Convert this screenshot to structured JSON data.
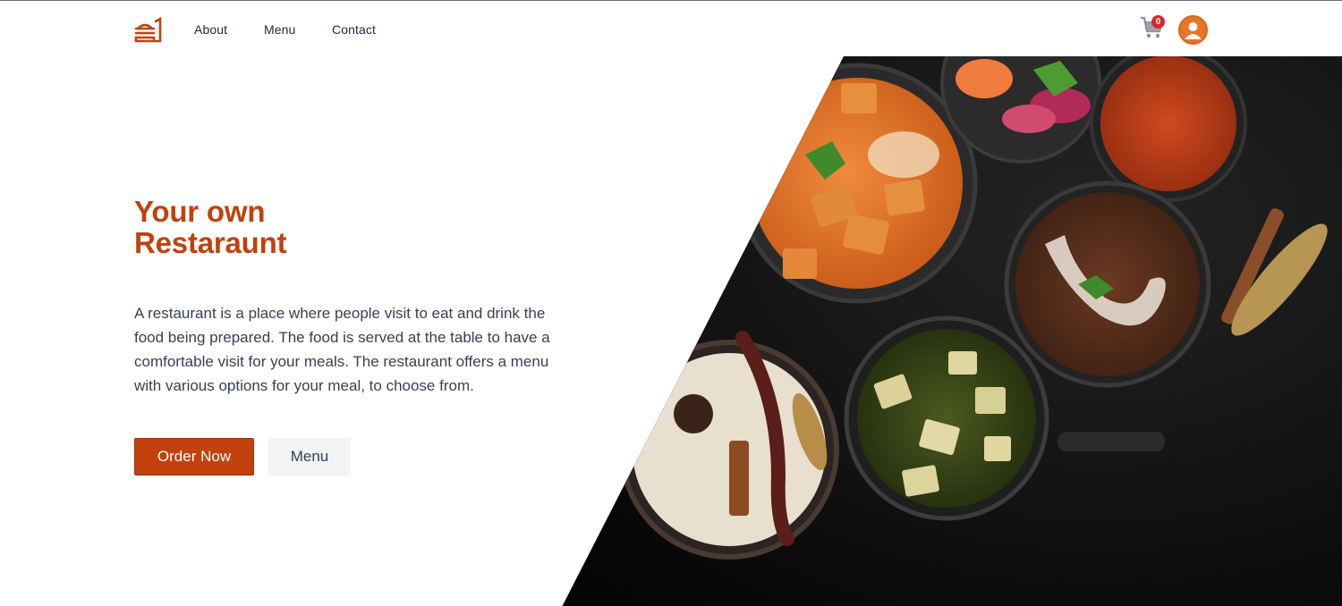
{
  "nav": {
    "logo_icon": "restaurant-logo-icon",
    "links": [
      "About",
      "Menu",
      "Contact"
    ],
    "cart_icon": "cart-icon",
    "cart_count": "0",
    "avatar_icon": "user-avatar-icon"
  },
  "hero": {
    "title_line1": "Your own",
    "title_line2": "Restaraunt",
    "description": "A restaurant is a place where people visit to eat and drink the food being prepared. The food is served at the table to have a comfortable visit for your meals. The restaurant offers a menu with various options for your meal, to choose from.",
    "order_button": "Order Now",
    "menu_button": "Menu"
  },
  "image": {
    "description_icon": "indian-food-bowls-image"
  },
  "colors": {
    "brand": "#c2410c",
    "avatar": "#ea7425",
    "badge": "#dc2626",
    "image_bg": "#141414"
  }
}
